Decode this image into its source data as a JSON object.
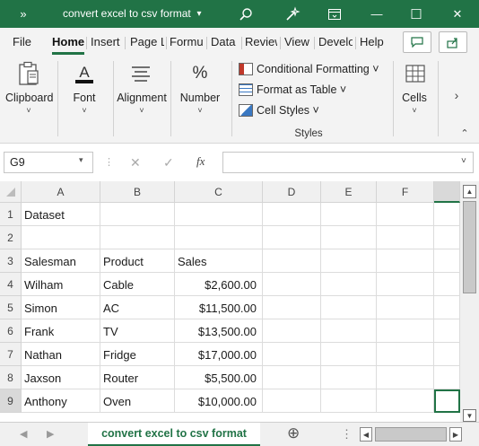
{
  "titlebar": {
    "title": "convert excel to csv format",
    "more_glyph": "»",
    "dropdown_glyph": "▾",
    "minimize_glyph": "—",
    "restore_glyph": "☐",
    "close_glyph": "✕"
  },
  "menu": {
    "items": [
      "File",
      "Home",
      "Insert",
      "Page L",
      "Formu",
      "Data",
      "Review",
      "View",
      "Develo",
      "Help"
    ],
    "active": "Home"
  },
  "ribbon": {
    "clipboard": "Clipboard",
    "font": "Font",
    "alignment": "Alignment",
    "number": "Number",
    "number_glyph": "%",
    "font_glyph": "A",
    "conditional_formatting": "Conditional Formatting ˅",
    "format_as_table": "Format as Table ˅",
    "cell_styles": "Cell Styles ˅",
    "styles_group": "Styles",
    "cells": "Cells",
    "chevron": "˅",
    "more": "›",
    "collapse": "⌃"
  },
  "formula_bar": {
    "name_box": "G9",
    "cancel_glyph": "✕",
    "enter_glyph": "✓",
    "fx_glyph": "fx",
    "formula": ""
  },
  "grid": {
    "columns": [
      "A",
      "B",
      "C",
      "D",
      "E",
      "F"
    ],
    "rows": [
      "1",
      "2",
      "3",
      "4",
      "5",
      "6",
      "7",
      "8",
      "9"
    ],
    "cells": {
      "A1": "Dataset",
      "A3": "Salesman",
      "B3": "Product",
      "C3": "Sales",
      "A4": "Wilham",
      "B4": "Cable",
      "C4": "$2,600.00",
      "A5": "Simon",
      "B5": "AC",
      "C5": "$11,500.00",
      "A6": "Frank",
      "B6": "TV",
      "C6": "$13,500.00",
      "A7": "Nathan",
      "B7": "Fridge",
      "C7": "$17,000.00",
      "A8": "Jaxson",
      "B8": "Router",
      "C8": "$5,500.00",
      "A9": "Anthony",
      "B9": "Oven",
      "C9": "$10,000.00"
    }
  },
  "sheet_tabs": {
    "active": "convert excel to csv format",
    "add_glyph": "⊕",
    "more_glyph": "⋮"
  },
  "colors": {
    "accent": "#217346",
    "titlebar": "#217346"
  }
}
